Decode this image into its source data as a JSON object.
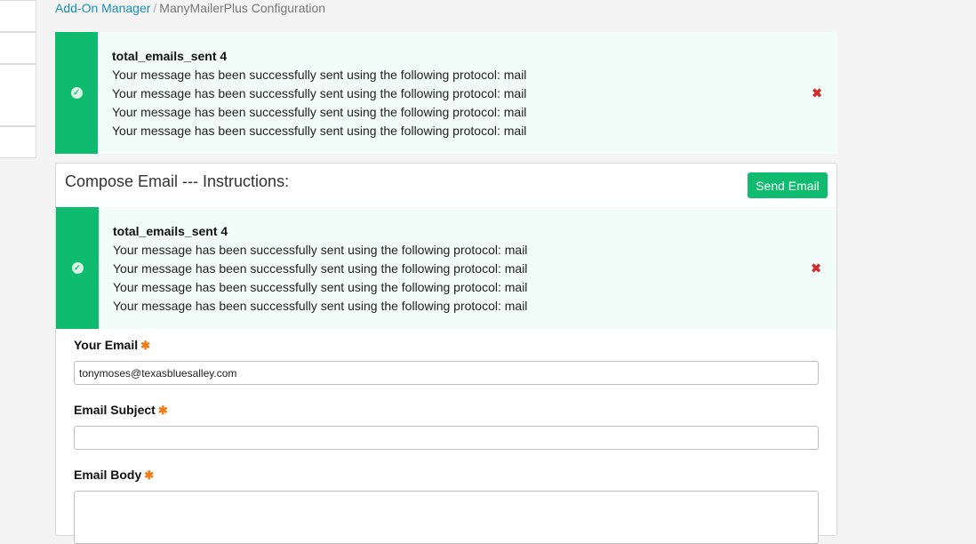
{
  "breadcrumb": {
    "parent": "Add-On Manager",
    "separator": "/",
    "current": "ManyMailerPlus Configuration"
  },
  "alerts": [
    {
      "title": "total_emails_sent 4",
      "messages": [
        "Your message has been successfully sent using the following protocol: mail",
        "Your message has been successfully sent using the following protocol: mail",
        "Your message has been successfully sent using the following protocol: mail",
        "Your message has been successfully sent using the following protocol: mail"
      ],
      "close_glyph": "✖"
    },
    {
      "title": "total_emails_sent 4",
      "messages": [
        "Your message has been successfully sent using the following protocol: mail",
        "Your message has been successfully sent using the following protocol: mail",
        "Your message has been successfully sent using the following protocol: mail",
        "Your message has been successfully sent using the following protocol: mail"
      ],
      "close_glyph": "✖"
    }
  ],
  "compose": {
    "title": "Compose Email --- Instructions:",
    "send_label": "Send Email",
    "fields": {
      "email": {
        "label": "Your Email",
        "value": "tonymoses@texasbluesalley.com"
      },
      "subject": {
        "label": "Email Subject",
        "value": ""
      },
      "body": {
        "label": "Email Body",
        "value": ""
      }
    },
    "required_mark": "✱"
  },
  "colors": {
    "success": "#0fbc6f",
    "alert_bg": "#f2fdf9",
    "link": "#1a8fb5",
    "danger": "#d12b2b",
    "required": "#f07b11"
  },
  "icons": {
    "success": "check-circle-icon",
    "close": "close-icon",
    "required": "asterisk-icon"
  }
}
